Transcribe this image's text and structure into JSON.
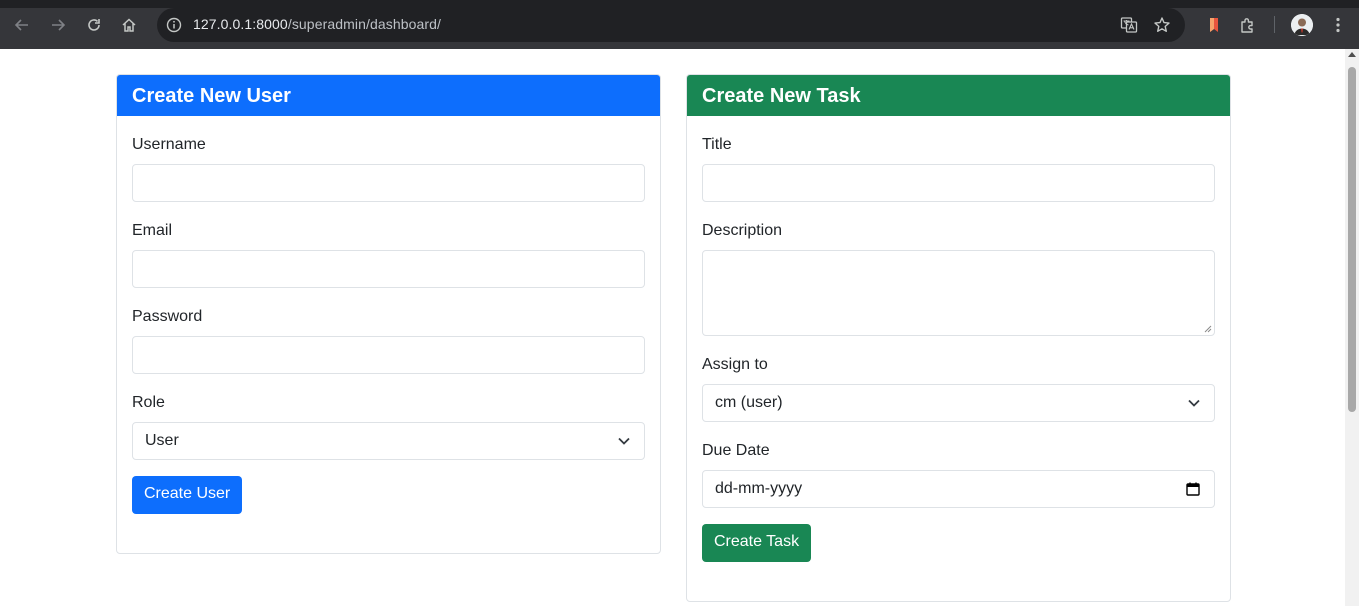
{
  "browser": {
    "url_host": "127.0.0.1:8000",
    "url_path": "/superadmin/dashboard/"
  },
  "user_form": {
    "title": "Create New User",
    "header_color": "#0d6efd",
    "fields": {
      "username_label": "Username",
      "email_label": "Email",
      "password_label": "Password",
      "role_label": "Role",
      "role_value": "User"
    },
    "submit_label": "Create User"
  },
  "task_form": {
    "title": "Create New Task",
    "header_color": "#198754",
    "fields": {
      "title_label": "Title",
      "description_label": "Description",
      "assign_label": "Assign to",
      "assign_value": "cm (user)",
      "due_label": "Due Date",
      "due_placeholder": "dd-mm-yyyy"
    },
    "submit_label": "Create Task"
  }
}
